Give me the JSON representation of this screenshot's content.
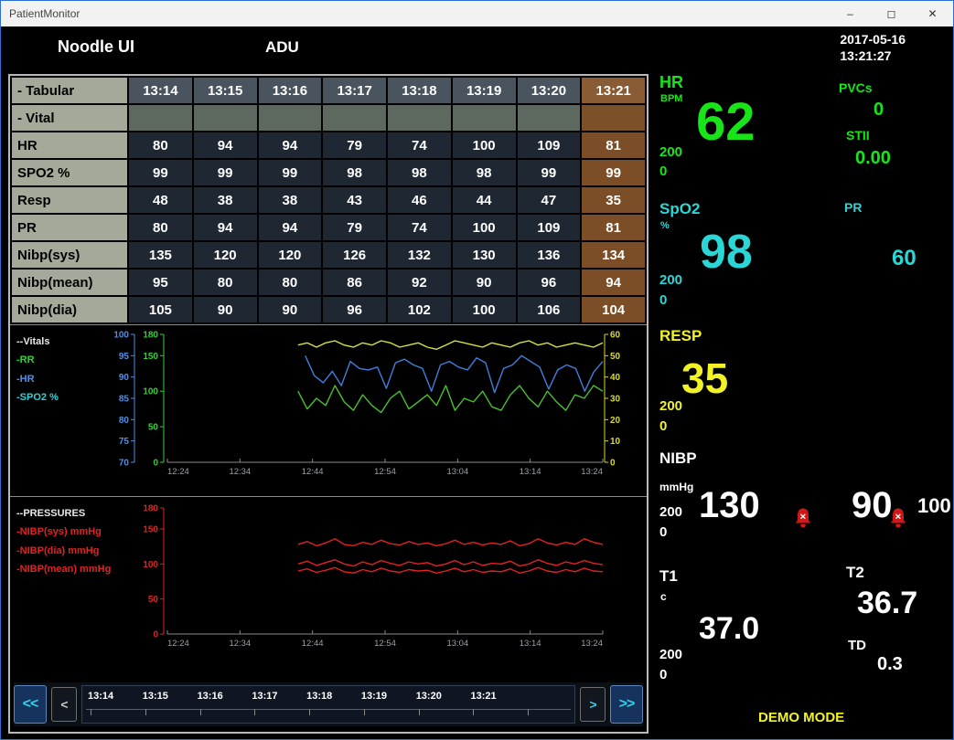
{
  "window": {
    "title": "PatientMonitor",
    "controls": {
      "minimize": "–",
      "maximize": "◻",
      "close": "✕"
    }
  },
  "header": {
    "brand": "Noodle UI",
    "unit": "ADU",
    "date": "2017-05-16",
    "time": "13:21:27"
  },
  "table": {
    "corner_label": "- Tabular",
    "section_label": "- Vital",
    "times": [
      "13:14",
      "13:15",
      "13:16",
      "13:17",
      "13:18",
      "13:19",
      "13:20",
      "13:21"
    ],
    "highlight_column": 7,
    "rows": [
      {
        "label": "HR",
        "values": [
          "80",
          "94",
          "94",
          "79",
          "74",
          "100",
          "109",
          "81"
        ]
      },
      {
        "label": "SPO2 %",
        "values": [
          "99",
          "99",
          "99",
          "98",
          "98",
          "98",
          "99",
          "99"
        ]
      },
      {
        "label": "Resp",
        "values": [
          "48",
          "38",
          "38",
          "43",
          "46",
          "44",
          "47",
          "35"
        ]
      },
      {
        "label": "PR",
        "values": [
          "80",
          "94",
          "94",
          "79",
          "74",
          "100",
          "109",
          "81"
        ]
      },
      {
        "label": "Nibp(sys)",
        "values": [
          "135",
          "120",
          "120",
          "126",
          "132",
          "130",
          "136",
          "134"
        ]
      },
      {
        "label": "Nibp(mean)",
        "values": [
          "95",
          "80",
          "80",
          "86",
          "92",
          "90",
          "96",
          "94"
        ]
      },
      {
        "label": "Nibp(dia)",
        "values": [
          "105",
          "90",
          "90",
          "96",
          "102",
          "100",
          "106",
          "104"
        ]
      }
    ]
  },
  "chart_data": [
    {
      "type": "line",
      "title": "--Vitals",
      "legend": [
        {
          "label": "-RR",
          "color": "#2fd32f"
        },
        {
          "label": "-HR",
          "color": "#4f8fe8"
        },
        {
          "label": "-SPO2 %",
          "color": "#2ad5d5"
        }
      ],
      "axes": {
        "spo2": {
          "side": "left",
          "color": "#4f8fe8",
          "min": 70,
          "max": 100,
          "ticks": [
            100,
            95,
            90,
            85,
            80,
            75,
            70
          ]
        },
        "scale": {
          "side": "left",
          "color": "#2fd32f",
          "min": 0,
          "max": 180,
          "ticks": [
            180,
            150,
            100,
            50,
            0
          ]
        },
        "rr": {
          "side": "right",
          "color": "#d9d92e",
          "min": 0,
          "max": 60,
          "ticks": [
            60,
            50,
            40,
            30,
            20,
            10,
            0
          ]
        }
      },
      "x_ticks": [
        "12:24",
        "12:34",
        "12:44",
        "12:54",
        "13:04",
        "13:14",
        "13:24"
      ],
      "x_total_minutes": 60,
      "series": [
        {
          "name": "spo2-trend",
          "color": "#d9e23e",
          "axis": "rr",
          "start_minute": 18,
          "values": [
            55,
            56,
            54,
            56,
            57,
            55,
            54,
            56,
            55,
            57,
            56,
            54,
            55,
            56,
            54,
            53,
            55,
            57,
            56,
            55,
            54,
            56,
            55,
            54,
            56,
            57,
            55,
            56,
            54,
            55,
            56,
            55,
            54,
            56
          ]
        },
        {
          "name": "hr-trend",
          "color": "#3f7fd9",
          "axis": "scale",
          "start_minute": 19,
          "values": [
            150,
            122,
            112,
            128,
            108,
            142,
            132,
            130,
            134,
            104,
            140,
            145,
            137,
            132,
            100,
            137,
            142,
            134,
            130,
            147,
            140,
            98,
            132,
            137,
            150,
            142,
            134,
            103,
            130,
            137,
            132,
            100,
            127,
            142
          ]
        },
        {
          "name": "rr-trend",
          "color": "#49c12c",
          "axis": "scale",
          "start_minute": 18,
          "values": [
            100,
            75,
            90,
            80,
            108,
            85,
            73,
            95,
            80,
            70,
            90,
            100,
            75,
            85,
            95,
            80,
            108,
            73,
            90,
            85,
            100,
            78,
            73,
            95,
            108,
            90,
            78,
            100,
            85,
            73,
            95,
            90,
            108,
            100
          ]
        }
      ]
    },
    {
      "type": "line",
      "title": "--PRESSURES",
      "legend": [
        {
          "label": "-NIBP(sys) mmHg",
          "color": "#e02222"
        },
        {
          "label": "-NIBP(dia) mmHg",
          "color": "#e02222"
        },
        {
          "label": "-NIBP(mean) mmHg",
          "color": "#e02222"
        }
      ],
      "axes": {
        "pressure": {
          "side": "left",
          "color": "#e02222",
          "min": 0,
          "max": 180,
          "ticks": [
            180,
            150,
            100,
            50,
            0
          ]
        }
      },
      "x_ticks": [
        "12:24",
        "12:34",
        "12:44",
        "12:54",
        "13:04",
        "13:14",
        "13:24"
      ],
      "x_total_minutes": 60,
      "series": [
        {
          "name": "nibp-sys",
          "color": "#e02222",
          "axis": "pressure",
          "start_minute": 18,
          "values": [
            128,
            132,
            126,
            130,
            136,
            128,
            126,
            131,
            128,
            134,
            129,
            127,
            132,
            128,
            130,
            126,
            129,
            134,
            128,
            131,
            127,
            130,
            128,
            133,
            126,
            129,
            136,
            130,
            127,
            131,
            128,
            136,
            131,
            128
          ]
        },
        {
          "name": "nibp-mean",
          "color": "#e02222",
          "axis": "pressure",
          "start_minute": 18,
          "values": [
            100,
            104,
            98,
            102,
            106,
            100,
            97,
            103,
            99,
            105,
            101,
            98,
            103,
            100,
            102,
            97,
            100,
            105,
            99,
            103,
            98,
            101,
            100,
            104,
            97,
            100,
            106,
            101,
            98,
            103,
            100,
            105,
            101,
            99
          ]
        },
        {
          "name": "nibp-dia",
          "color": "#e02222",
          "axis": "pressure",
          "start_minute": 18,
          "values": [
            90,
            93,
            88,
            91,
            95,
            89,
            87,
            92,
            89,
            94,
            90,
            88,
            92,
            90,
            91,
            87,
            90,
            94,
            89,
            92,
            88,
            90,
            89,
            93,
            87,
            90,
            95,
            90,
            88,
            92,
            89,
            94,
            90,
            89
          ]
        }
      ]
    }
  ],
  "timeline": {
    "labels": [
      "13:14",
      "13:15",
      "13:16",
      "13:17",
      "13:18",
      "13:19",
      "13:20",
      "13:21"
    ],
    "buttons": {
      "fast_back": "<<",
      "back": "<",
      "forward": ">",
      "fast_forward": ">>"
    }
  },
  "panel": {
    "colors": {
      "hr": "#17e517",
      "spo2": "#2bd6d6",
      "resp": "#f2f226",
      "nibp": "#ffffff",
      "alarm": "#d01818",
      "demo": "#f2f226"
    },
    "hr": {
      "label": "HR",
      "unit": "BPM",
      "value": "62",
      "limit_high": "200",
      "limit_low": "0"
    },
    "pvcs": {
      "label": "PVCs",
      "value": "0"
    },
    "stii": {
      "label": "STII",
      "value": "0.00"
    },
    "spo2": {
      "label": "SpO2",
      "unit": "%",
      "value": "98",
      "limit_high": "200",
      "limit_low": "0"
    },
    "pr": {
      "label": "PR",
      "value": "60"
    },
    "resp": {
      "label": "RESP",
      "value": "35",
      "limit_high": "200",
      "limit_low": "0"
    },
    "nibp": {
      "label": "NIBP",
      "unit": "mmHg",
      "sys": "130",
      "dia": "90",
      "map": "100",
      "limit_high": "200",
      "limit_low": "0"
    },
    "t1": {
      "label": "T1",
      "unit": "c",
      "value": "37.0",
      "limit_high": "200",
      "limit_low": "0"
    },
    "t2": {
      "label": "T2",
      "value": "36.7"
    },
    "td": {
      "label": "TD",
      "value": "0.3"
    },
    "mode": "DEMO MODE"
  }
}
